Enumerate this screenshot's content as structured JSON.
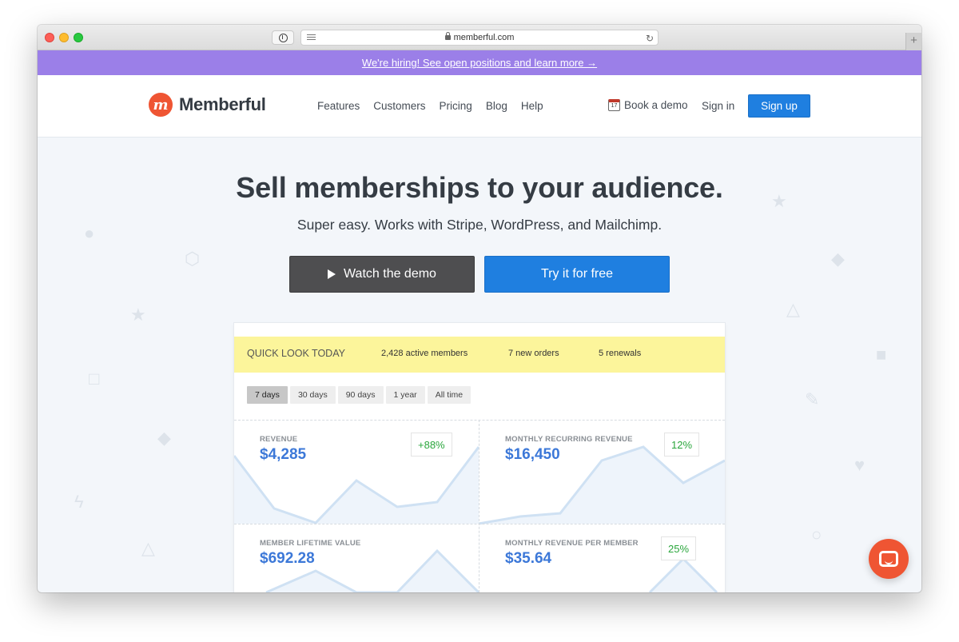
{
  "browser": {
    "url": "memberful.com"
  },
  "banner": {
    "text": "We're hiring! See open positions and learn more →"
  },
  "header": {
    "logo_text": "Memberful",
    "logo_letter": "m",
    "nav": [
      "Features",
      "Customers",
      "Pricing",
      "Blog",
      "Help"
    ],
    "book_demo": "Book a demo",
    "calendar_day": "17",
    "sign_in": "Sign in",
    "sign_up": "Sign up"
  },
  "hero": {
    "title": "Sell memberships to your audience.",
    "subtitle": "Super easy. Works with Stripe, WordPress, and Mailchimp.",
    "watch_demo": "Watch the demo",
    "try_free": "Try it for free"
  },
  "dashboard": {
    "quick_title": "QUICK LOOK TODAY",
    "active_members": "2,428 active members",
    "new_orders": "7 new orders",
    "renewals": "5 renewals",
    "filters": [
      "7 days",
      "30 days",
      "90 days",
      "1 year",
      "All time"
    ],
    "active_filter": 0,
    "metrics": [
      {
        "label": "REVENUE",
        "value": "$4,285",
        "badge": "+88%"
      },
      {
        "label": "MONTHLY RECURRING REVENUE",
        "value": "$16,450",
        "badge": "12%"
      },
      {
        "label": "MEMBER LIFETIME VALUE",
        "value": "$692.28",
        "badge": ""
      },
      {
        "label": "MONTHLY REVENUE PER MEMBER",
        "value": "$35.64",
        "badge": "25%"
      }
    ]
  },
  "colors": {
    "brand_orange": "#ef5533",
    "primary_blue": "#1f7fe0",
    "banner_purple": "#9b7fe8",
    "quick_yellow": "#fcf59b",
    "positive_green": "#2aa63c",
    "metric_blue": "#3c78d8"
  },
  "icons": {
    "chat": "chat-bubble-icon",
    "calendar": "calendar-icon",
    "play": "play-icon",
    "lock": "lock-icon",
    "reload": "reload-icon"
  }
}
